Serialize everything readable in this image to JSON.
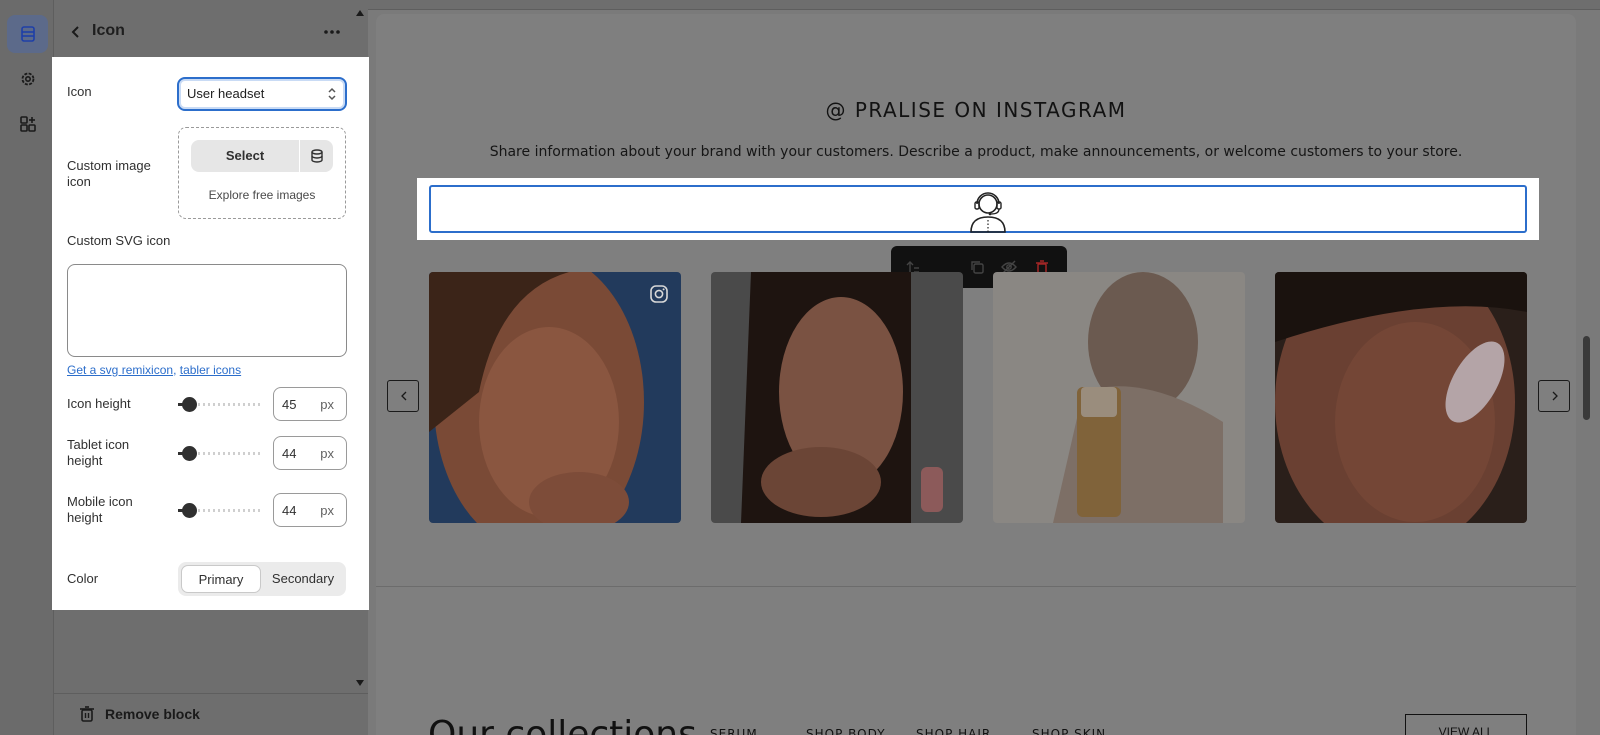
{
  "panel": {
    "title": "Icon",
    "remove_label": "Remove block"
  },
  "settings": {
    "icon_label": "Icon",
    "icon_value": "User headset",
    "custom_image_label": "Custom image icon",
    "select_label": "Select",
    "explore_label": "Explore free images",
    "custom_svg_label": "Custom SVG icon",
    "custom_svg_value": "",
    "link_prefix": "Get a svg ",
    "link_remix": "remixicon",
    "link_sep": ", ",
    "link_tabler": "tabler icons",
    "icon_height": {
      "label": "Icon height",
      "value": "45",
      "unit": "px",
      "fraction": 0.05
    },
    "tablet_height": {
      "label": "Tablet icon height",
      "value": "44",
      "unit": "px",
      "fraction": 0.05
    },
    "mobile_height": {
      "label": "Mobile icon height",
      "value": "44",
      "unit": "px",
      "fraction": 0.05
    },
    "color_label": "Color",
    "color_options": [
      "Primary",
      "Secondary"
    ],
    "color_selected": "Primary"
  },
  "preview": {
    "ig_title": "@ PRALISE ON INSTAGRAM",
    "ig_subtitle": "Share information about your brand with your customers. Describe a product, make announcements, or welcome customers to your store.",
    "collections_title": "Our collections",
    "collection_links": [
      "SERUM",
      "SHOP BODY",
      "SHOP HAIR",
      "SHOP SKIN"
    ],
    "view_all": "VIEW ALL"
  },
  "colors": {
    "accent": "#2c6ecb",
    "toolbar": "#111111",
    "delete": "#e03131"
  }
}
